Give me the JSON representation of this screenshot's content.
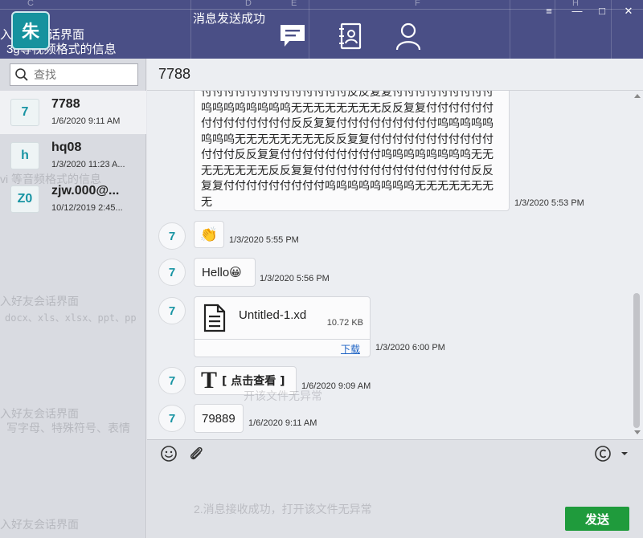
{
  "window": {
    "my_avatar_text": "朱",
    "status_text": "消息发送成功",
    "bg_text_1": "入好友会话界面",
    "bg_text_2": "3g等视频格式的信息",
    "col_headers": [
      "C",
      "D",
      "E",
      "F",
      "H"
    ],
    "controls": {
      "menu": "≡",
      "minimize": "—",
      "maximize": "□",
      "close": "✕"
    }
  },
  "nav": {
    "messages_icon": "chat-bubble-icon",
    "contacts_icon": "address-book-icon",
    "profile_icon": "user-icon"
  },
  "search": {
    "placeholder": "查找"
  },
  "contacts": [
    {
      "avatar": "7",
      "name": "7788",
      "time": "1/6/2020 9:11 AM",
      "active": true
    },
    {
      "avatar": "h",
      "name": "hq08",
      "time": "1/3/2020 11:23 A...",
      "active": false
    },
    {
      "avatar": "Z0",
      "name": "zjw.000@...",
      "time": "10/12/2019 2:45...",
      "active": false
    }
  ],
  "chat": {
    "title": "7788",
    "long_message": {
      "text": "付付付付付付付付付付付付付反反复复付付付付付付付付付呜呜呜呜呜呜呜呜无无无无无无无无反反复复付付付付付付付付付付付付付付反反复复付付付付付付付付付呜呜呜呜呜呜呜呜无无无无无无无无反反复复付付付付付付付付付付付付付付反反复复付付付付付付付付付呜呜呜呜呜呜呜呜无无无无无无无无反反复复付付付付付付付付付付付付付付反反复复付付付付付付付付付呜呜呜呜呜呜呜呜无无无无无无无无",
      "time": "1/3/2020 5:53 PM"
    },
    "messages": [
      {
        "avatar": "7",
        "content": "👏",
        "time": "1/3/2020 5:55 PM"
      },
      {
        "avatar": "7",
        "content": "Hello😀",
        "time": "1/3/2020 5:56 PM"
      },
      {
        "avatar": "7",
        "file_name": "Untitled-1.xd",
        "file_size": "10.72 KB",
        "download": "下载",
        "time": "1/3/2020 6:00 PM"
      },
      {
        "avatar": "7",
        "content": "[ 点击查看 ]",
        "time": "1/6/2020 9:09 AM"
      },
      {
        "avatar": "7",
        "content": "79889",
        "time": "1/6/2020 9:11 AM"
      }
    ]
  },
  "bg_ghost": {
    "line_a": "vi 等音频格式的信息",
    "line_b": "入好友会话界面",
    "line_c": "docx、xls、xlsx、ppt、pp",
    "line_d": "入好友会话界面",
    "line_e": "写字母、特殊符号、表情",
    "line_f": "2.消息接收成功，打开该文件无异常",
    "line_g": "入好友会话界面",
    "line_h": "开该文件无异常"
  },
  "input": {
    "emoji_icon": "smiley-icon",
    "attach_icon": "paperclip-icon",
    "screenshot_icon": "copyright-circle-icon",
    "send_label": "发送"
  },
  "colors": {
    "topbar": "#4a4f86",
    "accent": "#1894a3",
    "send": "#1f9b3c"
  }
}
